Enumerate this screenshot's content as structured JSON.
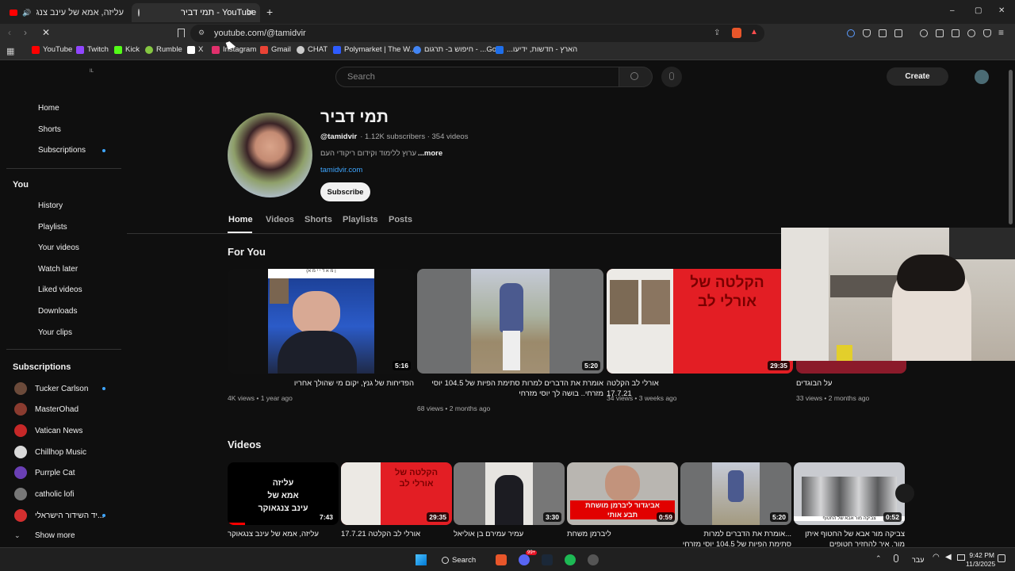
{
  "browser": {
    "tabs": [
      {
        "title": "עליזה, אמא של עינב צנגאוקר"
      },
      {
        "title": "YouTube - תמי דביר"
      }
    ],
    "new_tab": "+",
    "url": "youtube.com/@tamidvir",
    "window_controls": {
      "minimize": "–",
      "maximize": "▢",
      "close": "✕"
    },
    "bookmarks": [
      {
        "label": "YouTube",
        "color": "#ff0000"
      },
      {
        "label": "Twitch",
        "color": "#9146ff"
      },
      {
        "label": "Kick",
        "color": "#53fc18"
      },
      {
        "label": "Rumble",
        "color": "#85c742"
      },
      {
        "label": "X",
        "color": "#ffffff"
      },
      {
        "label": "Instagram",
        "color": "#e1306c"
      },
      {
        "label": "Gmail",
        "color": "#ea4335"
      },
      {
        "label": "CHAT",
        "color": "#cccccc"
      },
      {
        "label": "Polymarket | The W...",
        "color": "#2e5cff"
      },
      {
        "label": "Go... - חיפוש ב- תרגום",
        "color": "#4285f4"
      },
      {
        "label": "הארץ - חדשות, ידיעו...",
        "color": "#1f6feb"
      }
    ]
  },
  "youtube": {
    "search_placeholder": "Search",
    "create": "Create",
    "sidebar": {
      "main": [
        {
          "label": "Home"
        },
        {
          "label": "Shorts"
        },
        {
          "label": "Subscriptions"
        }
      ],
      "you_header": "You",
      "you": [
        {
          "label": "History"
        },
        {
          "label": "Playlists"
        },
        {
          "label": "Your videos"
        },
        {
          "label": "Watch later"
        },
        {
          "label": "Liked videos"
        },
        {
          "label": "Downloads"
        },
        {
          "label": "Your clips"
        }
      ],
      "subs_header": "Subscriptions",
      "subs": [
        {
          "label": "Tucker Carlson",
          "color": "#6b4a3a",
          "new": true
        },
        {
          "label": "MasterOhad",
          "color": "#8a3b2f",
          "new": false
        },
        {
          "label": "Vatican News",
          "color": "#c62828",
          "new": false
        },
        {
          "label": "Chillhop Music",
          "color": "#d9d9d9",
          "new": false
        },
        {
          "label": "Purrple Cat",
          "color": "#6a3fb5",
          "new": false
        },
        {
          "label": "catholic lofi",
          "color": "#777777",
          "new": false
        },
        {
          "label": "...יד השידור הישראלי",
          "color": "#d32f2f",
          "new": true
        }
      ],
      "show_more": "Show more"
    },
    "channel": {
      "name": "תמי דביר",
      "handle": "@tamidvir",
      "stats": "· 1.12K subscribers · 354 videos",
      "description": "ערוץ ללימוד וקידום ריקודי העם",
      "more": "...more",
      "link": "tamidvir.com",
      "subscribe": "Subscribe",
      "tabs": [
        {
          "label": "Home"
        },
        {
          "label": "Videos"
        },
        {
          "label": "Shorts"
        },
        {
          "label": "Playlists"
        },
        {
          "label": "Posts"
        }
      ]
    },
    "for_you": {
      "title": "For You",
      "videos": [
        {
          "title": "הפדיחות של גנץ, יקום מי שהולך אחריו",
          "meta": "4K views • 1 year ago",
          "duration": "5:16"
        },
        {
          "title": "אומרת את הדברים למרות סתימת הפיות של 104.5 יוסי מזרחי.. בושה לך יוסי מזרחי",
          "meta": "68 views • 2 months ago",
          "duration": "5:20"
        },
        {
          "title": "אורלי לב הקלטה 17.7.21",
          "meta": "34 views • 3 weeks ago",
          "duration": "29:35"
        },
        {
          "title": "על הבוגדים",
          "meta": "33 views • 2 months ago",
          "duration": ""
        }
      ]
    },
    "videos": {
      "title": "Videos",
      "items": [
        {
          "title": "עליזה, אמא של עינב צנגאוקר",
          "duration": "7:43",
          "thumb_text": "עליזה\nאמא של\nעינב צנגאוקר"
        },
        {
          "title": "אורלי לב הקלטה 17.7.21",
          "duration": "29:35",
          "thumb_text": "הקלטה של\nאורלי לב"
        },
        {
          "title": "עמיר עמירם בן אוליאל",
          "duration": "3:30",
          "thumb_text": ""
        },
        {
          "title": "ליברמן משחת",
          "duration": "0:59",
          "thumb_text": "אביגדור ליברמן מושחת\nתבע אותי"
        },
        {
          "title": "...אומרת את הדברים למרות סתימת הפיות של 104.5 יוסי מזרחי",
          "duration": "5:20",
          "thumb_text": ""
        },
        {
          "title": "צביקה מור אבא של החטוף איתן מור, איך להחזיר חטופים",
          "duration": "0:52",
          "thumb_text": "צביקה מור אבא של החטוף"
        }
      ]
    },
    "thumb_overlays": {
      "gantz_top": "(ן מ א  ד י י  מ א"
    }
  },
  "taskbar": {
    "search": "Search",
    "language": "עבר",
    "time": "9:42 PM",
    "date": "11/3/2025",
    "badge": "99+"
  }
}
